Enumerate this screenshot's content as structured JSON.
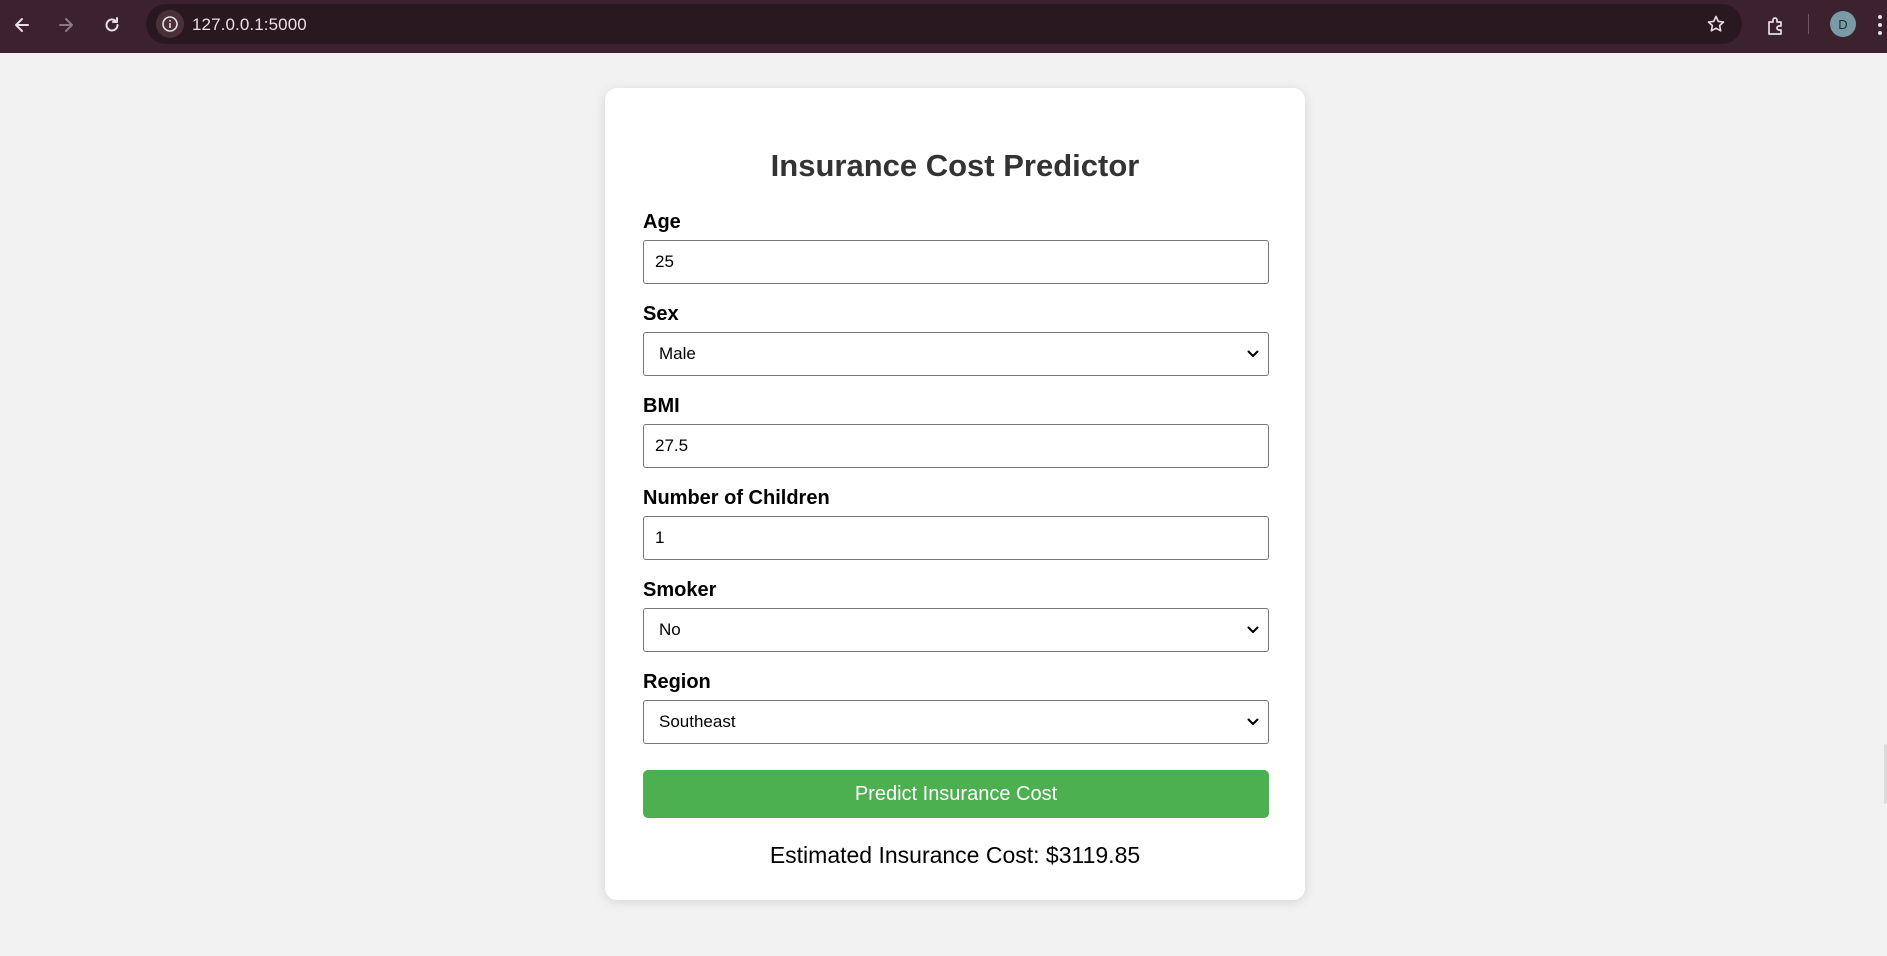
{
  "browser": {
    "url": "127.0.0.1:5000",
    "avatar_initial": "D",
    "icons": {
      "back": "arrow-left-icon",
      "forward": "arrow-right-icon",
      "reload": "reload-icon",
      "site_info": "info-icon",
      "bookmark": "star-icon",
      "extensions": "puzzle-icon",
      "menu": "kebab-menu-icon"
    }
  },
  "form": {
    "title": "Insurance Cost Predictor",
    "age": {
      "label": "Age",
      "value": "25"
    },
    "sex": {
      "label": "Sex",
      "value": "Male"
    },
    "bmi": {
      "label": "BMI",
      "value": "27.5"
    },
    "children": {
      "label": "Number of Children",
      "value": "1"
    },
    "smoker": {
      "label": "Smoker",
      "value": "No"
    },
    "region": {
      "label": "Region",
      "value": "Southeast"
    },
    "submit_label": "Predict Insurance Cost",
    "result_text": "Estimated Insurance Cost: $3119.85"
  },
  "colors": {
    "browser_bar": "#3c222e",
    "page_bg": "#f2f2f2",
    "button": "#4caf50",
    "title": "#333333"
  }
}
